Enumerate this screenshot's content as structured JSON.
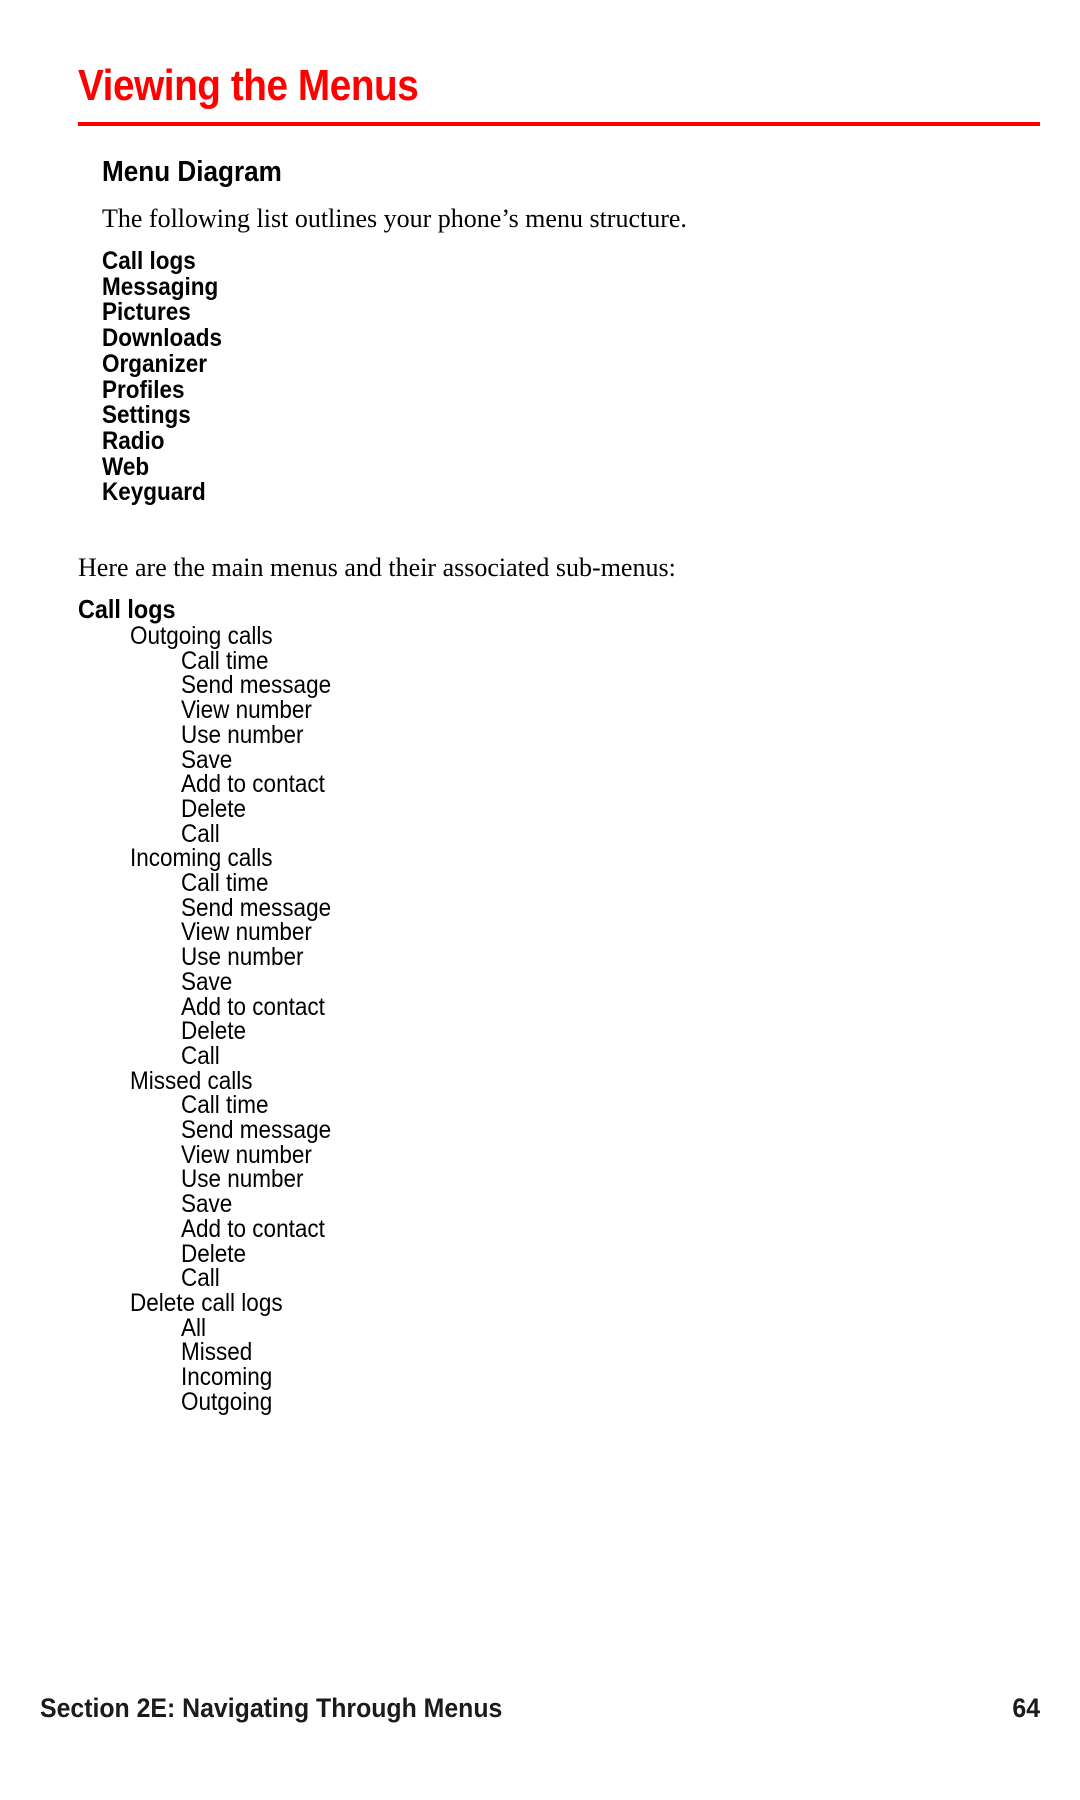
{
  "page": {
    "title": "Viewing the Menus",
    "accent_color": "#ff0000",
    "text_color": "#000000",
    "background_color": "#ffffff"
  },
  "section": {
    "heading": "Menu Diagram",
    "intro_paragraph": "The following list outlines your phone’s menu structure.",
    "mid_paragraph": "Here are the main menus and their associated sub-menus:"
  },
  "main_menu": [
    {
      "label": "Call logs"
    },
    {
      "label": "Messaging"
    },
    {
      "label": "Pictures"
    },
    {
      "label": "Downloads"
    },
    {
      "label": "Organizer"
    },
    {
      "label": "Profiles"
    },
    {
      "label": "Settings"
    },
    {
      "label": "Radio"
    },
    {
      "label": "Web"
    },
    {
      "label": "Keyguard"
    }
  ],
  "menu_tree": [
    {
      "level": 0,
      "label": "Call logs"
    },
    {
      "level": 1,
      "label": "Outgoing calls"
    },
    {
      "level": 2,
      "label": "Call time"
    },
    {
      "level": 2,
      "label": "Send message"
    },
    {
      "level": 2,
      "label": "View number"
    },
    {
      "level": 2,
      "label": "Use number"
    },
    {
      "level": 2,
      "label": "Save"
    },
    {
      "level": 2,
      "label": "Add to contact"
    },
    {
      "level": 2,
      "label": "Delete"
    },
    {
      "level": 2,
      "label": "Call"
    },
    {
      "level": 1,
      "label": "Incoming calls"
    },
    {
      "level": 2,
      "label": "Call time"
    },
    {
      "level": 2,
      "label": "Send message"
    },
    {
      "level": 2,
      "label": "View number"
    },
    {
      "level": 2,
      "label": "Use number"
    },
    {
      "level": 2,
      "label": "Save"
    },
    {
      "level": 2,
      "label": "Add to contact"
    },
    {
      "level": 2,
      "label": "Delete"
    },
    {
      "level": 2,
      "label": "Call"
    },
    {
      "level": 1,
      "label": "Missed calls"
    },
    {
      "level": 2,
      "label": "Call time"
    },
    {
      "level": 2,
      "label": "Send message"
    },
    {
      "level": 2,
      "label": "View number"
    },
    {
      "level": 2,
      "label": "Use number"
    },
    {
      "level": 2,
      "label": "Save"
    },
    {
      "level": 2,
      "label": "Add to contact"
    },
    {
      "level": 2,
      "label": "Delete"
    },
    {
      "level": 2,
      "label": "Call"
    },
    {
      "level": 1,
      "label": "Delete call logs"
    },
    {
      "level": 2,
      "label": "All"
    },
    {
      "level": 2,
      "label": "Missed"
    },
    {
      "level": 2,
      "label": "Incoming"
    },
    {
      "level": 2,
      "label": "Outgoing"
    }
  ],
  "footer": {
    "section_label": "Section 2E: Navigating Through Menus",
    "page_number": "64"
  }
}
